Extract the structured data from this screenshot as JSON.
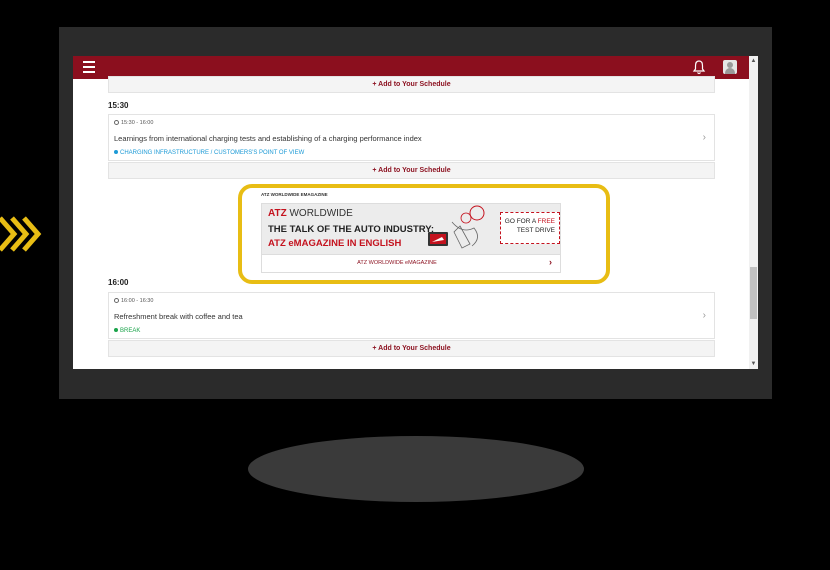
{
  "colors": {
    "brand": "#8b0f1e",
    "highlight": "#e8bd14",
    "tag_blue": "#1c9ad6",
    "tag_green": "#1aa34a"
  },
  "header": {
    "menu_icon": "hamburger-icon",
    "bell_icon": "bell-icon",
    "user_icon": "user-avatar-icon"
  },
  "schedule": {
    "add_label_1": "+ Add to Your Schedule",
    "time_1530": "15:30",
    "session1": {
      "time": "15:30 - 16:00",
      "title": "Learnings from international charging tests and establishing of a charging performance index",
      "tag": "CHARGING INFRASTRUCTURE / CUSTOMERS'S POINT OF VIEW"
    },
    "add_label_2": "+ Add to Your Schedule",
    "ad": {
      "label": "ATZ WORLDWIDE EMAGAZINE",
      "logo_brand": "ATZ",
      "logo_rest": "WORLDWIDE",
      "line1": "THE TALK OF THE AUTO INDUSTRY:",
      "line2": "ATZ eMAGAZINE IN ENGLISH",
      "cta_part1": "GO FOR A",
      "cta_free": "FREE",
      "cta_part2": "TEST DRIVE",
      "footer": "ATZ WORLDWIDE eMAGAZINE"
    },
    "time_1600": "16:00",
    "session2": {
      "time": "16:00 - 16:30",
      "title": "Refreshment break with coffee and tea",
      "tag": "BREAK"
    },
    "add_label_3": "+ Add to Your Schedule"
  }
}
